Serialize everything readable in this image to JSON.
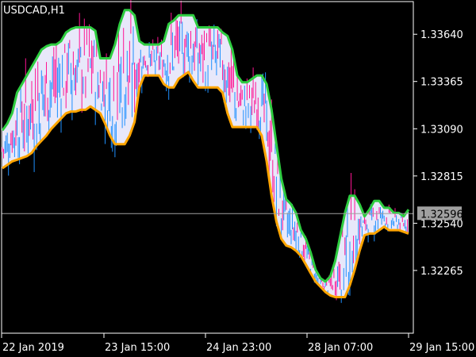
{
  "chart_data": {
    "type": "line",
    "title": "USDCAD,H1",
    "symbol": "USDCAD",
    "timeframe": "H1",
    "y_ticks": [
      "1.33640",
      "1.33365",
      "1.33090",
      "1.32815",
      "1.32540",
      "1.32265"
    ],
    "y_range": [
      1.319,
      1.3383
    ],
    "current_price": "1.32596",
    "x_ticks": [
      "22 Jan 2019",
      "23 Jan 15:00",
      "24 Jan 23:00",
      "28 Jan 07:00",
      "29 Jan 15:00"
    ],
    "grid": false,
    "colors": {
      "background": "#000000",
      "axis": "#ffffff",
      "upper_band": "#2ecc40",
      "lower_band": "#ffa500",
      "band_fill": "#e8e8fa",
      "bull_candle": "#1e90ff",
      "bear_candle": "#ff1493",
      "neutral_candle": "#c8c8ff",
      "price_line": "#a0a0a0",
      "price_label_bg": "#a0a0a0"
    },
    "series": [
      {
        "name": "upper",
        "values": [
          1.3308,
          1.3312,
          1.3318,
          1.333,
          1.3335,
          1.334,
          1.3345,
          1.335,
          1.3355,
          1.3357,
          1.3358,
          1.3358,
          1.336,
          1.3365,
          1.3367,
          1.3368,
          1.3368,
          1.3368,
          1.3368,
          1.3366,
          1.335,
          1.335,
          1.335,
          1.3358,
          1.337,
          1.3378,
          1.3378,
          1.3375,
          1.336,
          1.3358,
          1.3358,
          1.3358,
          1.3358,
          1.336,
          1.337,
          1.3372,
          1.3375,
          1.3375,
          1.3375,
          1.3375,
          1.3368,
          1.3368,
          1.3368,
          1.3368,
          1.3368,
          1.3365,
          1.3363,
          1.3355,
          1.334,
          1.3336,
          1.3336,
          1.3338,
          1.334,
          1.334,
          1.3335,
          1.332,
          1.33,
          1.328,
          1.3268,
          1.3265,
          1.326,
          1.325,
          1.3245,
          1.3237,
          1.3227,
          1.3222,
          1.322,
          1.3223,
          1.3232,
          1.3246,
          1.326,
          1.327,
          1.327,
          1.3265,
          1.3258,
          1.3262,
          1.3267,
          1.3267,
          1.3263,
          1.3263,
          1.326,
          1.326,
          1.3258,
          1.3262
        ]
      },
      {
        "name": "lower",
        "values": [
          1.3286,
          1.3288,
          1.329,
          1.3291,
          1.3292,
          1.3293,
          1.3295,
          1.3299,
          1.3302,
          1.3305,
          1.3309,
          1.3312,
          1.3315,
          1.3318,
          1.3319,
          1.3319,
          1.332,
          1.332,
          1.3322,
          1.332,
          1.3318,
          1.3312,
          1.3305,
          1.33,
          1.33,
          1.33,
          1.3305,
          1.3313,
          1.3333,
          1.334,
          1.334,
          1.334,
          1.334,
          1.3335,
          1.3333,
          1.3333,
          1.3338,
          1.334,
          1.3342,
          1.3337,
          1.3333,
          1.3333,
          1.3333,
          1.3333,
          1.3333,
          1.333,
          1.3318,
          1.331,
          1.331,
          1.331,
          1.331,
          1.331,
          1.331,
          1.3305,
          1.329,
          1.327,
          1.3255,
          1.3245,
          1.3241,
          1.324,
          1.3238,
          1.3235,
          1.323,
          1.3225,
          1.322,
          1.3217,
          1.3214,
          1.3212,
          1.3211,
          1.3211,
          1.3211,
          1.3218,
          1.3227,
          1.3238,
          1.3247,
          1.3248,
          1.3248,
          1.325,
          1.3252,
          1.325,
          1.325,
          1.325,
          1.3249,
          1.3248
        ]
      }
    ]
  }
}
